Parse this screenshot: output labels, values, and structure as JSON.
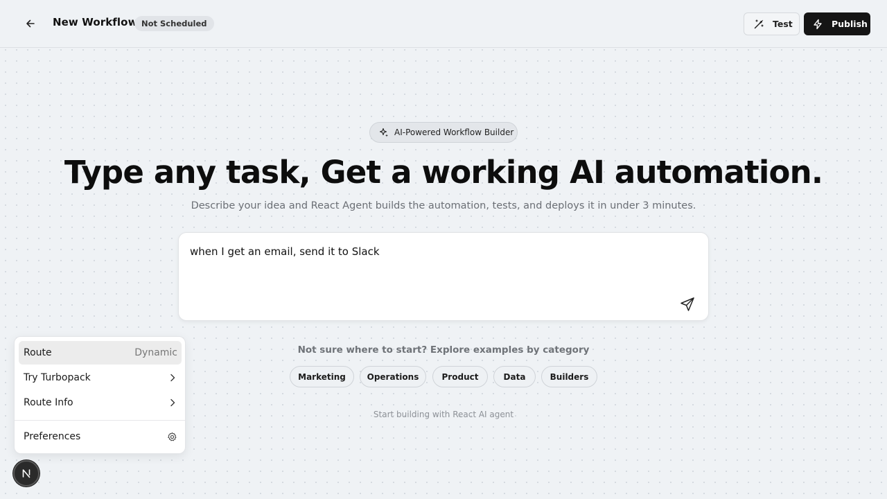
{
  "header": {
    "title": "New Workflow",
    "status": "Not Scheduled",
    "test_label": "Test",
    "publish_label": "Publish",
    "back_icon": "arrow-left-icon",
    "test_icon": "magic-wand-icon",
    "publish_icon": "lightning-icon"
  },
  "hero": {
    "badge": "AI-Powered Workflow Builder",
    "badge_icon": "sparkles-icon",
    "headline": "Type any task, Get a working AI automation.",
    "subline": "Describe your idea and React Agent builds the automation, tests, and deploys it in under 3 minutes."
  },
  "prompt": {
    "value": "when I get an email, send it to Slack",
    "send_icon": "send-icon"
  },
  "examples": {
    "label": "Not sure where to start? Explore examples by category",
    "categories": [
      "Marketing",
      "Operations",
      "Product",
      "Data",
      "Builders"
    ]
  },
  "footer": {
    "note": "Start building with React AI agent"
  },
  "dev_menu": {
    "items": [
      {
        "label": "Route",
        "value": "Dynamic"
      },
      {
        "label": "Try Turbopack"
      },
      {
        "label": "Route Info"
      },
      {
        "label": "Preferences"
      }
    ],
    "badge_letter": "N"
  },
  "colors": {
    "background": "#eff2f5",
    "publish_bg": "#151515",
    "headline": "#0d0d0d"
  }
}
